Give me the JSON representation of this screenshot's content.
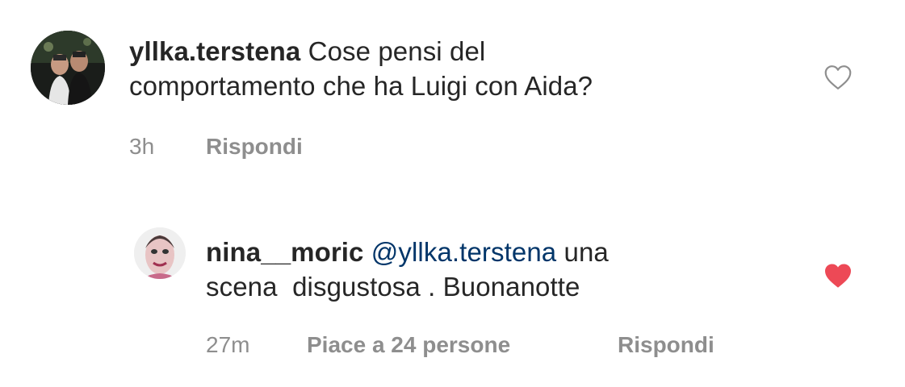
{
  "comments": [
    {
      "username": "yllka.terstena",
      "line1": "Cose pensi del",
      "line2": "comportamento che ha Luigi con Aida?",
      "time": "3h",
      "reply_label": "Rispondi",
      "liked": false,
      "heart_color": "#8e8e8e"
    },
    {
      "username": "nina__moric",
      "mention": "@yllka.terstena",
      "line1_rest": " una",
      "line2": "scena  disgustosa . Buonanotte",
      "time": "27m",
      "likes_label": "Piace a 24 persone",
      "reply_label": "Rispondi",
      "liked": true,
      "heart_color": "#ed4956"
    }
  ],
  "colors": {
    "text": "#262626",
    "meta": "#8e8e8e",
    "mention": "#003569",
    "liked_heart": "#ed4956"
  }
}
